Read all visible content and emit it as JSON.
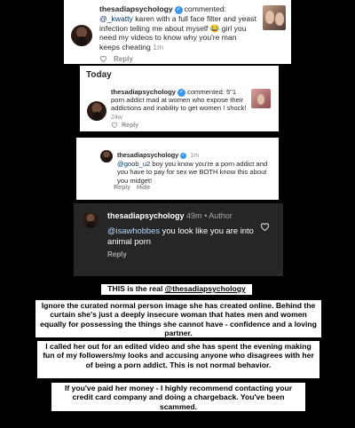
{
  "comment1": {
    "username": "thesadiapsychology",
    "action": "commented:",
    "mention": "@_kwatty",
    "text_a": "karen with a full face filter and yeast infection telling me about myself",
    "emoji": "😂",
    "text_b": "girl you need my videos to know why you're man keeps cheating",
    "time": "1m",
    "reply_label": "Reply"
  },
  "section": {
    "today_label": "Today"
  },
  "comment2": {
    "username": "thesadiapsychology",
    "action": "commented:",
    "text": "5\"1 porn addict mad at women who expose their addictions and inability to get women ! shock!",
    "time": "24w",
    "reply_label": "Reply"
  },
  "comment3": {
    "username": "thesadiapsychology",
    "time": "1m",
    "mention": "@goob_u2",
    "text": "boy you know you're a porn addict and you have to pay for sex we BOTH know this about you midget!",
    "reply_label": "Reply",
    "hide_label": "Hide"
  },
  "comment4": {
    "username": "thesadiapsychology",
    "time": "49m",
    "author_label": "Author",
    "mention": "@isawhobbes",
    "text": "you look like you are into  animal porn",
    "reply_label": "Reply"
  },
  "captions": {
    "line1_prefix": "THIS is the real",
    "line1_handle": "@thesadiapsychology",
    "para1": "Ignore the curated normal person image she has created online. Behind the curtain she's just a deeply insecure woman that hates men and women equally for possessing the things she cannot have - confidence and a loving partner.",
    "para2": "I called her out for an edited video and she has spent the evening making fun of my followers/my looks and accusing anyone who disagrees with her of being a porn addict. This is not normal behavior.",
    "para3": "If you've paid her money - I highly recommend contacting your credit card company and doing a chargeback. You've been scammed."
  },
  "colors": {
    "background": "#000000",
    "card": "#ffffff",
    "dark_card": "#262626",
    "link": "#00376b",
    "dark_link": "#e0f1ff",
    "verified": "#3897f0"
  }
}
